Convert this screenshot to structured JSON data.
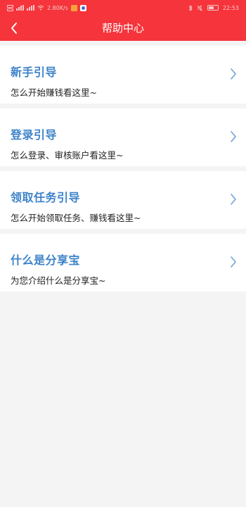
{
  "status_bar": {
    "speed": "2.80K/s",
    "time": "22:53",
    "icons": [
      "sim-icon",
      "signal-icon",
      "wifi-icon",
      "notification-icon",
      "bluetooth-icon",
      "mute-icon",
      "battery-icon"
    ]
  },
  "header": {
    "title": "帮助中心",
    "back_icon": "chevron-left-icon",
    "background": "#f5343c"
  },
  "items": [
    {
      "title": "新手引导",
      "subtitle": "怎么开始赚钱看这里~"
    },
    {
      "title": "登录引导",
      "subtitle": "怎么登录、审核账户看这里~"
    },
    {
      "title": "领取任务引导",
      "subtitle": "怎么开始领取任务、赚钱看这里~"
    },
    {
      "title": "什么是分享宝",
      "subtitle": "为您介绍什么是分享宝~"
    }
  ],
  "colors": {
    "accent": "#f5343c",
    "title_blue": "#3d83c9",
    "chevron": "#6fa2d8",
    "page_bg": "#f4f4f4"
  }
}
